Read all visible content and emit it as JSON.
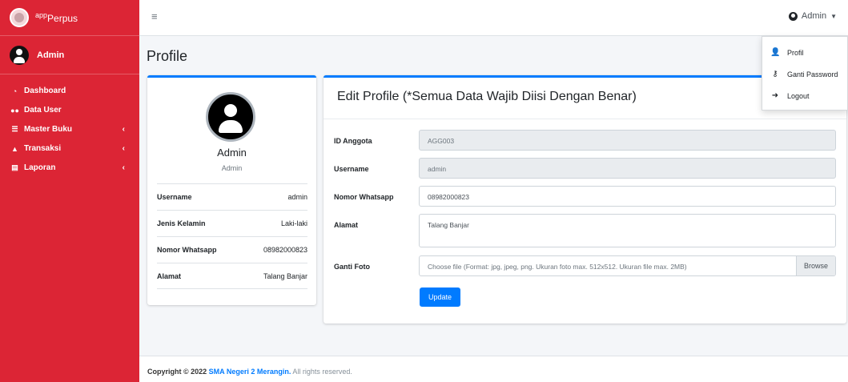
{
  "brand": {
    "prefix": "app",
    "name": "Perpus"
  },
  "sidebar": {
    "user_name": "Admin",
    "items": [
      {
        "label": "Dashboard",
        "icon": "dashboard-icon",
        "caret": ""
      },
      {
        "label": "Data User",
        "icon": "users-icon",
        "caret": ""
      },
      {
        "label": "Master Buku",
        "icon": "database-icon",
        "caret": "‹"
      },
      {
        "label": "Transaksi",
        "icon": "chart-area-icon",
        "caret": "‹"
      },
      {
        "label": "Laporan",
        "icon": "file-icon",
        "caret": "‹"
      }
    ]
  },
  "topbar": {
    "user_label": "Admin"
  },
  "dropdown": {
    "items": [
      {
        "label": "Profil",
        "icon": "user-icon"
      },
      {
        "label": "Ganti Password",
        "icon": "key-icon"
      },
      {
        "label": "Logout",
        "icon": "sign-out-icon"
      }
    ]
  },
  "page": {
    "title": "Profile"
  },
  "profile": {
    "name": "Admin",
    "role": "Admin",
    "rows": [
      {
        "label": "Username",
        "value": "admin"
      },
      {
        "label": "Jenis Kelamin",
        "value": "Laki-laki"
      },
      {
        "label": "Nomor Whatsapp",
        "value": "08982000823"
      },
      {
        "label": "Alamat",
        "value": "Talang Banjar"
      }
    ]
  },
  "edit": {
    "title": "Edit Profile (*Semua Data Wajib Diisi Dengan Benar)",
    "id_label": "ID Anggota",
    "id_value": "AGG003",
    "username_label": "Username",
    "username_value": "admin",
    "whatsapp_label": "Nomor Whatsapp",
    "whatsapp_value": "08982000823",
    "alamat_label": "Alamat",
    "alamat_value": "Talang Banjar",
    "foto_label": "Ganti Foto",
    "foto_placeholder": "Choose file (Format: jpg, jpeg, png. Ukuran foto max. 512x512. Ukuran file max. 2MB)",
    "browse_label": "Browse",
    "update_label": "Update"
  },
  "footer": {
    "prefix": "Copyright © 2022",
    "link": "SMA Negeri 2 Merangin.",
    "suffix": "All rights reserved."
  }
}
